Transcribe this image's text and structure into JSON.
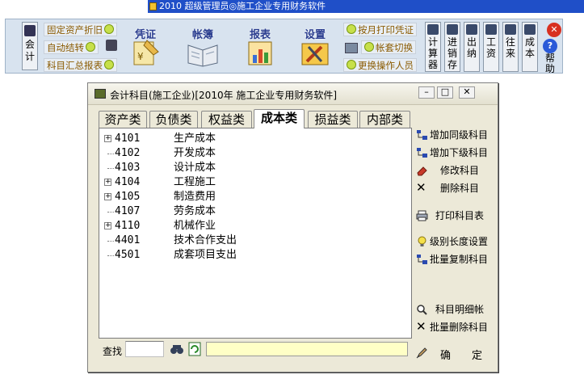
{
  "window_title": "2010 超级管理员◎施工企业专用财务软件",
  "toolbar": {
    "left_button": "会计",
    "links_left": [
      "固定资产折旧",
      "自动结转",
      "科目汇总报表"
    ],
    "tools": [
      "凭证",
      "帐簿",
      "报表",
      "设置"
    ],
    "links_right": [
      "按月打印凭证",
      "帐套切换",
      "更换操作人员"
    ],
    "buttons": [
      "计算器",
      "进销存",
      "出纳",
      "工资",
      "往来",
      "成本"
    ],
    "help_label": "帮助"
  },
  "dialog": {
    "title": "会计科目(施工企业)[2010年 施工企业专用财务软件]",
    "tabs": [
      "资产类",
      "负债类",
      "权益类",
      "成本类",
      "损益类",
      "内部类"
    ],
    "active_tab": "成本类",
    "rows": [
      {
        "code": "4101",
        "name": "生产成本",
        "expandable": true
      },
      {
        "code": "4102",
        "name": "开发成本",
        "expandable": false
      },
      {
        "code": "4103",
        "name": "设计成本",
        "expandable": false
      },
      {
        "code": "4104",
        "name": "工程施工",
        "expandable": true
      },
      {
        "code": "4105",
        "name": "制造费用",
        "expandable": true
      },
      {
        "code": "4107",
        "name": "劳务成本",
        "expandable": false
      },
      {
        "code": "4110",
        "name": "机械作业",
        "expandable": true
      },
      {
        "code": "4401",
        "name": "技术合作支出",
        "expandable": false
      },
      {
        "code": "4501",
        "name": "成套项目支出",
        "expandable": false
      }
    ],
    "side_buttons": {
      "add_same_level": "增加同级科目",
      "add_sub_level": "增加下级科目",
      "edit": "修改科目",
      "delete": "删除科目",
      "print": "打印科目表",
      "level_length": "级别长度设置",
      "batch_copy": "批量复制科目",
      "detail_ledger": "科目明细帐",
      "batch_delete": "批量删除科目"
    },
    "search_label": "查找",
    "search_value": "",
    "confirm_label": "确　　定"
  }
}
